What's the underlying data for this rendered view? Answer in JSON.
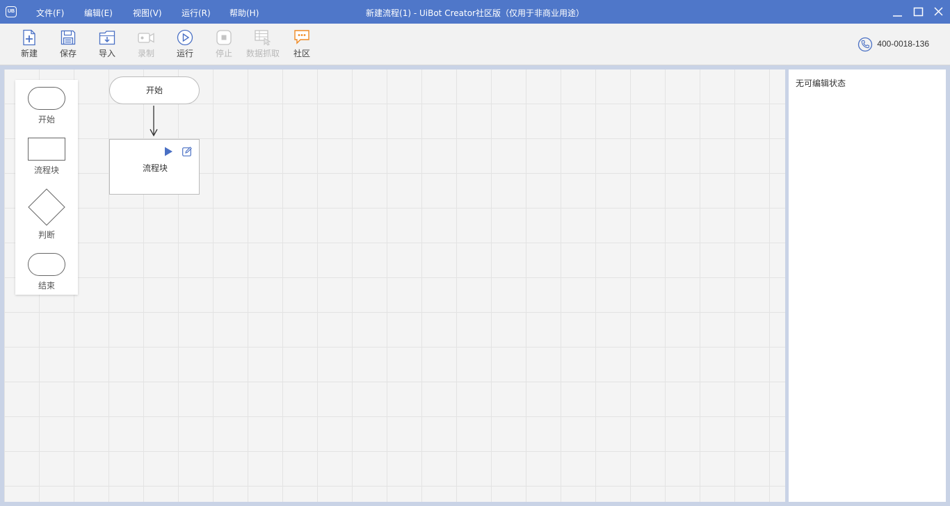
{
  "titlebar": {
    "logo_text": "UB",
    "title": "新建流程(1) - UiBot Creator社区版（仅用于非商业用途）",
    "menus": [
      "文件(F)",
      "编辑(E)",
      "视图(V)",
      "运行(R)",
      "帮助(H)"
    ]
  },
  "toolbar": {
    "items": [
      {
        "label": "新建",
        "icon": "new-file-icon",
        "enabled": true
      },
      {
        "label": "保存",
        "icon": "save-icon",
        "enabled": true
      },
      {
        "label": "导入",
        "icon": "import-icon",
        "enabled": true
      },
      {
        "label": "录制",
        "icon": "record-icon",
        "enabled": false
      },
      {
        "label": "运行",
        "icon": "run-icon",
        "enabled": true
      },
      {
        "label": "停止",
        "icon": "stop-icon",
        "enabled": false
      },
      {
        "label": "数据抓取",
        "icon": "data-capture-icon",
        "enabled": false
      },
      {
        "label": "社区",
        "icon": "community-icon",
        "enabled": true
      }
    ],
    "hotline": "400-0018-136"
  },
  "palette": {
    "items": [
      {
        "label": "开始",
        "shape": "rounded"
      },
      {
        "label": "流程块",
        "shape": "rectangle"
      },
      {
        "label": "判断",
        "shape": "diamond"
      },
      {
        "label": "结束",
        "shape": "rounded"
      }
    ]
  },
  "flow": {
    "start_label": "开始",
    "block_label": "流程块"
  },
  "properties": {
    "status": "无可编辑状态"
  },
  "colors": {
    "titlebar": "#4f77c9",
    "accent": "#4a70c4",
    "community": "#f08a24"
  }
}
